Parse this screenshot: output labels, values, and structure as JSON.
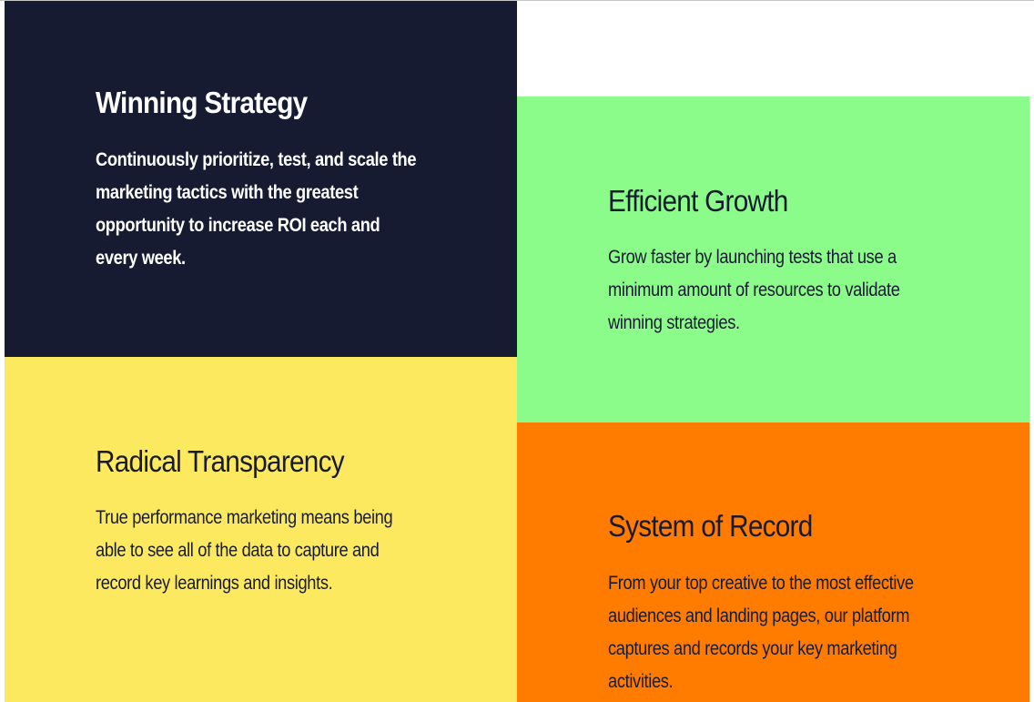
{
  "colors": {
    "navy": "#171b31",
    "green": "#8bfc89",
    "yellow": "#fde95f",
    "orange": "#ff7c00",
    "white": "#ffffff"
  },
  "cards": [
    {
      "title": "Winning Strategy",
      "body": "Continuously prioritize, test, and scale the marketing tactics with the greatest opportunity to increase ROI each and every week.",
      "background": "#171b31",
      "text_color": "#ffffff"
    },
    {
      "title": "Efficient Growth",
      "body": "Grow faster by launching tests that use a minimum amount of resources to validate winning strategies.",
      "background": "#8bfc89",
      "text_color": "#171b31"
    },
    {
      "title": "Radical Transparency",
      "body": "True performance marketing means being able to see all of the data to capture and record key learnings and insights.",
      "background": "#fde95f",
      "text_color": "#171b31"
    },
    {
      "title": "System of Record",
      "body": "From your top creative to the most effective audiences and landing pages, our platform captures and records your key marketing activities.",
      "background": "#ff7c00",
      "text_color": "#171b31"
    }
  ]
}
